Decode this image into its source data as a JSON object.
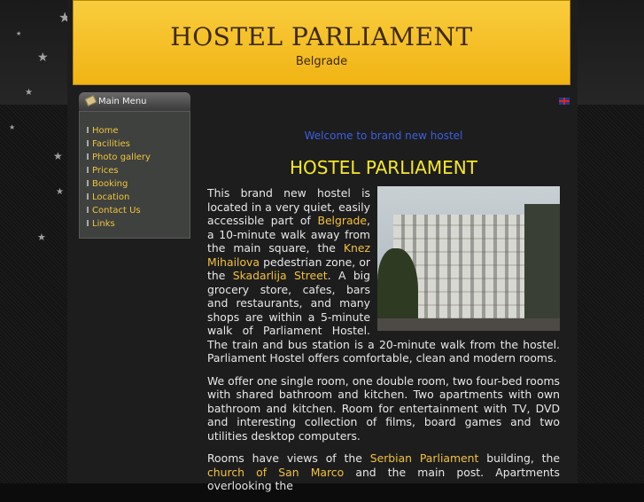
{
  "header": {
    "title": "HOSTEL PARLIAMENT",
    "subtitle": "Belgrade"
  },
  "menu": {
    "title": "Main Menu",
    "items": [
      {
        "label": "Home"
      },
      {
        "label": "Facilities"
      },
      {
        "label": "Photo gallery"
      },
      {
        "label": "Prices"
      },
      {
        "label": "Booking"
      },
      {
        "label": "Location"
      },
      {
        "label": "Contact Us"
      },
      {
        "label": "Links"
      }
    ]
  },
  "language": {
    "icon": "uk-flag-icon"
  },
  "main": {
    "welcome": "Welcome to brand new hostel",
    "heading": "HOSTEL PARLIAMENT",
    "p1": {
      "t1": "This brand new hostel is located in a very quiet, easily accessible part of ",
      "l1": "Belgrade",
      "t2": ", a 10-minute walk away from the main square, the ",
      "l2": "Knez Mihailova",
      "t3": " pedestrian zone, or the ",
      "l3": "Skadarlija Street",
      "t4": ". A big grocery store, cafes, bars and restaurants, and many shops are within a 5-minute walk of Parliament Hostel. The train and bus station is a 20-minute walk from the hostel. Parliament Hostel offers comfortable, clean and modern rooms."
    },
    "p2": "We offer one single room, one double room, two four-bed rooms with shared bathroom and kitchen. Two apartments with own bathroom and kitchen. Room for entertainment with TV, DVD and interesting collection of films, board games and two utilities desktop computers.",
    "p3": {
      "t1": "Rooms have views of the ",
      "l1": "Serbian Parliament",
      "t2": " building, the ",
      "l2": "church of San Marco",
      "t3": " and the main post. Apartments overlooking the"
    }
  },
  "colors": {
    "header_bg": "#f1b414",
    "link": "#f2c23b",
    "welcome": "#3d5ee0",
    "heading": "#f6e826"
  }
}
